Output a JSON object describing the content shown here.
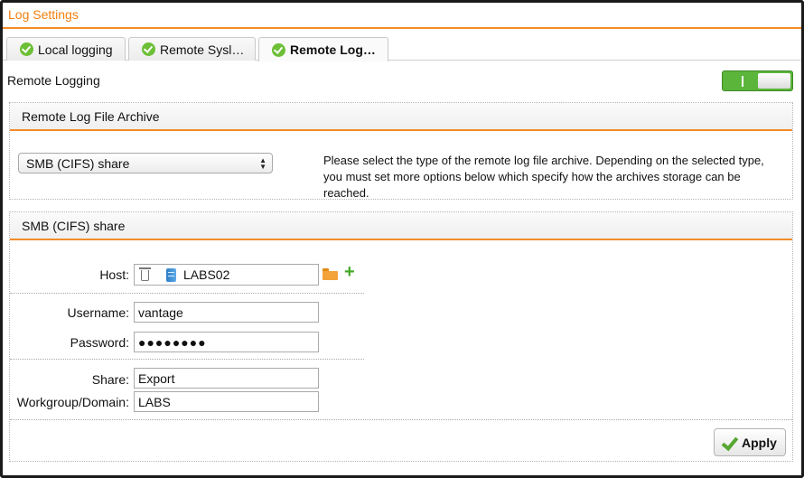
{
  "header": {
    "title": "Log Settings"
  },
  "tabs": [
    {
      "label": "Local logging",
      "active": false
    },
    {
      "label": "Remote Sysl…",
      "active": false
    },
    {
      "label": "Remote Log…",
      "active": true
    }
  ],
  "remote_logging": {
    "label": "Remote Logging",
    "enabled": true
  },
  "archive_panel": {
    "title": "Remote Log File Archive",
    "type_select": {
      "value": "SMB (CIFS) share"
    },
    "description": "Please select the type of the remote log file archive. Depending on the selected type, you must set more options below which specify how the archives storage can be reached."
  },
  "smb_panel": {
    "title": "SMB (CIFS) share",
    "host": {
      "label": "Host:",
      "value": "LABS02"
    },
    "username": {
      "label": "Username:",
      "value": "vantage"
    },
    "password": {
      "label": "Password:",
      "value": "●●●●●●●●"
    },
    "share": {
      "label": "Share:",
      "value": "Export"
    },
    "workgroup": {
      "label": "Workgroup/Domain:",
      "value": "LABS"
    },
    "apply_label": "Apply"
  },
  "colors": {
    "accent": "#f28c28",
    "toggle_on": "#5bb53a",
    "check": "#6cbf36"
  }
}
